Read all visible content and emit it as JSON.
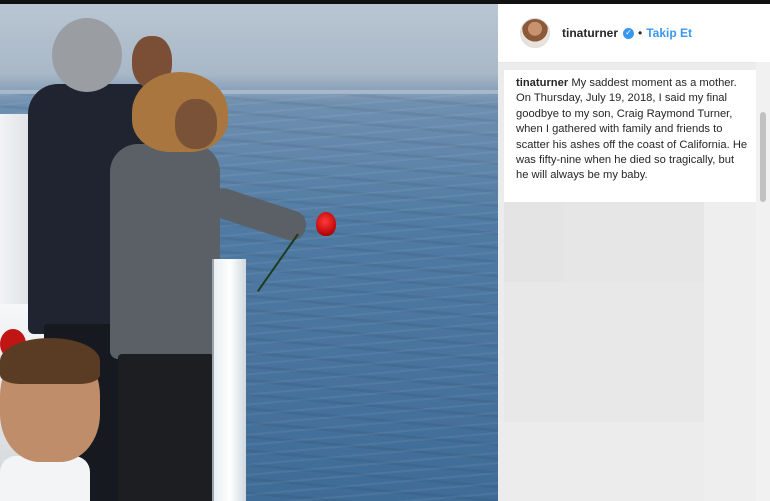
{
  "post": {
    "username": "tinaturner",
    "follow_label": "Takip Et",
    "separator": "•",
    "verified_glyph": "✓",
    "caption_username": "tinaturner",
    "caption_text": "My saddest moment as a mother. On Thursday, July 19, 2018, I said my final goodbye to my son, Craig Raymond Turner, when I gathered with family and friends to scatter his ashes off the coast of California. He was fifty-nine when he died so tragically, but he will always be my baby."
  },
  "colors": {
    "link_blue": "#3897f0",
    "text_dark": "#262626",
    "panel_bg": "#ececec"
  },
  "icons": {
    "verified": "verified-badge-icon"
  }
}
